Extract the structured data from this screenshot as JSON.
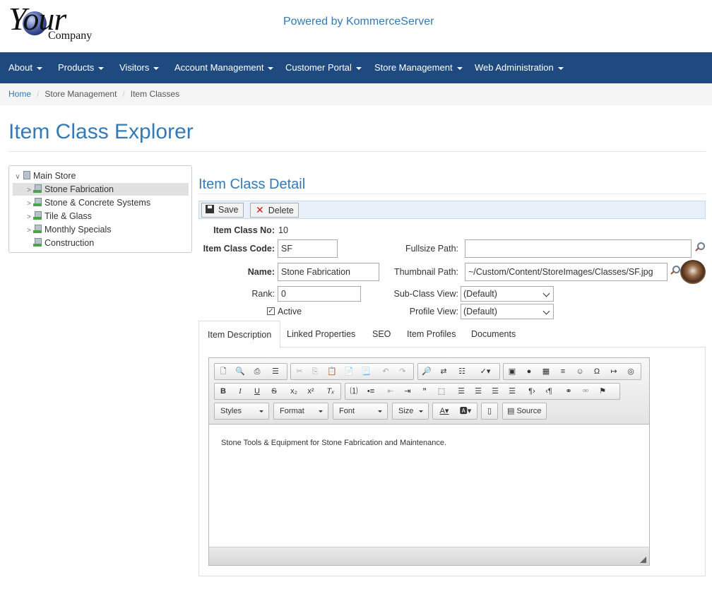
{
  "header": {
    "logo_text": "Your",
    "logo_sub": "Company",
    "powered": "Powered by KommerceServer"
  },
  "nav": [
    "About",
    "Products",
    "Visitors",
    "Account Management",
    "Customer Portal",
    "Store Management",
    "Web Administration"
  ],
  "breadcrumb": {
    "home": "Home",
    "section": "Store Management",
    "current": "Item Classes"
  },
  "page_title": "Item Class Explorer",
  "tree": {
    "root": "Main Store",
    "items": [
      "Stone Fabrication",
      "Stone & Concrete Systems",
      "Tile & Glass",
      "Monthly Specials",
      "Construction"
    ]
  },
  "detail": {
    "title": "Item Class Detail",
    "save_label": "Save",
    "delete_label": "Delete",
    "item_class_no_label": "Item Class No:",
    "item_class_no": "10",
    "code_label": "Item Class Code:",
    "code": "SF",
    "name_label": "Name:",
    "name": "Stone Fabrication",
    "rank_label": "Rank:",
    "rank": "0",
    "active_label": "Active",
    "fullsize_label": "Fullsize Path:",
    "fullsize": "",
    "thumbnail_label": "Thumbnail Path:",
    "thumbnail": "~/Custom/Content/StoreImages/Classes/SF.jpg",
    "subclass_label": "Sub-Class View:",
    "subclass": "(Default)",
    "profile_label": "Profile View:",
    "profile": "(Default)"
  },
  "tabs": [
    "Item Description",
    "Linked Properties",
    "SEO",
    "Item Profiles",
    "Documents"
  ],
  "editor": {
    "styles": "Styles",
    "format": "Format",
    "font": "Font",
    "size": "Size",
    "source": "Source",
    "content": "Stone Tools & Equipment for Stone Fabrication and Maintenance."
  }
}
